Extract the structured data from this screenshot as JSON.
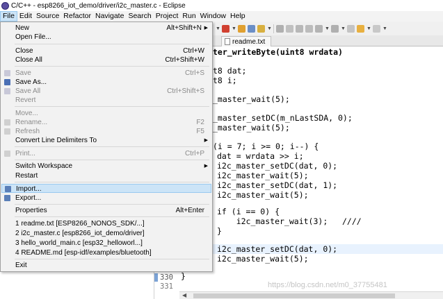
{
  "window": {
    "title": "C/C++ - esp8266_iot_demo/driver/i2c_master.c - Eclipse"
  },
  "menubar": [
    "File",
    "Edit",
    "Source",
    "Refactor",
    "Navigate",
    "Search",
    "Project",
    "Run",
    "Window",
    "Help"
  ],
  "editor": {
    "tab_label": "readme.txt",
    "code_lines": [
      {
        "text": "ter_writeByte(uint8 wrdata)"
      },
      {
        "text": ""
      },
      {
        "text": "t8 dat;"
      },
      {
        "text": "t8 i;"
      },
      {
        "text": ""
      },
      {
        "text": "_master_wait(5);"
      },
      {
        "text": ""
      },
      {
        "text": "_master_setDC(m_nLastSDA, 0);"
      },
      {
        "text": "_master_wait(5);"
      },
      {
        "text": ""
      },
      {
        "text": "(i = 7; i >= 0; i--) {"
      },
      {
        "text": "dat = wrdata >> i;"
      },
      {
        "text": "i2c_master_setDC(dat, 0);"
      },
      {
        "text": "i2c_master_wait(5);"
      },
      {
        "text": "i2c_master_setDC(dat, 1);"
      },
      {
        "text": "i2c_master_wait(5);"
      },
      {
        "text": ""
      },
      {
        "text": "if (i == 0) {"
      },
      {
        "text": "    i2c_master_wait(3);   ////"
      },
      {
        "text": "}"
      },
      {
        "text": ""
      },
      {
        "text": "i2c_master_setDC(dat, 0);"
      },
      {
        "text": "i2c_master_wait(5);"
      }
    ],
    "line_numbers": [
      "330",
      "331"
    ],
    "closing_brace": "}",
    "watermark": "https://blog.csdn.net/m0_37755481"
  },
  "file_menu": {
    "items": [
      {
        "label": "New",
        "shortcut": "Alt+Shift+N",
        "submenu": true,
        "disabled": false
      },
      {
        "label": "Open File...",
        "shortcut": "",
        "disabled": false
      },
      {
        "separator": true
      },
      {
        "label": "Close",
        "shortcut": "Ctrl+W",
        "disabled": false
      },
      {
        "label": "Close All",
        "shortcut": "Ctrl+Shift+W",
        "disabled": false
      },
      {
        "separator": true
      },
      {
        "label": "Save",
        "shortcut": "Ctrl+S",
        "disabled": true,
        "icon": "save-icon"
      },
      {
        "label": "Save As...",
        "shortcut": "",
        "disabled": false,
        "icon": "save-as-icon"
      },
      {
        "label": "Save All",
        "shortcut": "Ctrl+Shift+S",
        "disabled": true,
        "icon": "save-all-icon"
      },
      {
        "label": "Revert",
        "shortcut": "",
        "disabled": true
      },
      {
        "separator": true
      },
      {
        "label": "Move...",
        "shortcut": "",
        "disabled": true
      },
      {
        "label": "Rename...",
        "shortcut": "F2",
        "disabled": true,
        "icon": "rename-icon"
      },
      {
        "label": "Refresh",
        "shortcut": "F5",
        "disabled": true,
        "icon": "refresh-icon"
      },
      {
        "label": "Convert Line Delimiters To",
        "shortcut": "",
        "submenu": true,
        "disabled": false
      },
      {
        "separator": true
      },
      {
        "label": "Print...",
        "shortcut": "Ctrl+P",
        "disabled": true,
        "icon": "print-icon"
      },
      {
        "separator": true
      },
      {
        "label": "Switch Workspace",
        "shortcut": "",
        "submenu": true,
        "disabled": false
      },
      {
        "label": "Restart",
        "shortcut": "",
        "disabled": false
      },
      {
        "separator": true
      },
      {
        "label": "Import...",
        "shortcut": "",
        "disabled": false,
        "selected": true,
        "icon": "import-icon"
      },
      {
        "label": "Export...",
        "shortcut": "",
        "disabled": false,
        "icon": "export-icon"
      },
      {
        "separator": true
      },
      {
        "label": "Properties",
        "shortcut": "Alt+Enter",
        "disabled": false
      },
      {
        "separator": true
      },
      {
        "label": "1 readme.txt  [ESP8266_NONOS_SDK/...]",
        "shortcut": "",
        "disabled": false
      },
      {
        "label": "2 i2c_master.c  [esp8266_iot_demo/driver]",
        "shortcut": "",
        "disabled": false
      },
      {
        "label": "3 hello_world_main.c  [esp32_helloworl...]",
        "shortcut": "",
        "disabled": false
      },
      {
        "label": "4 README.md  [esp-idf/examples/bluetooth]",
        "shortcut": "",
        "disabled": false
      },
      {
        "separator": true
      },
      {
        "label": "Exit",
        "shortcut": "",
        "disabled": false
      }
    ]
  }
}
